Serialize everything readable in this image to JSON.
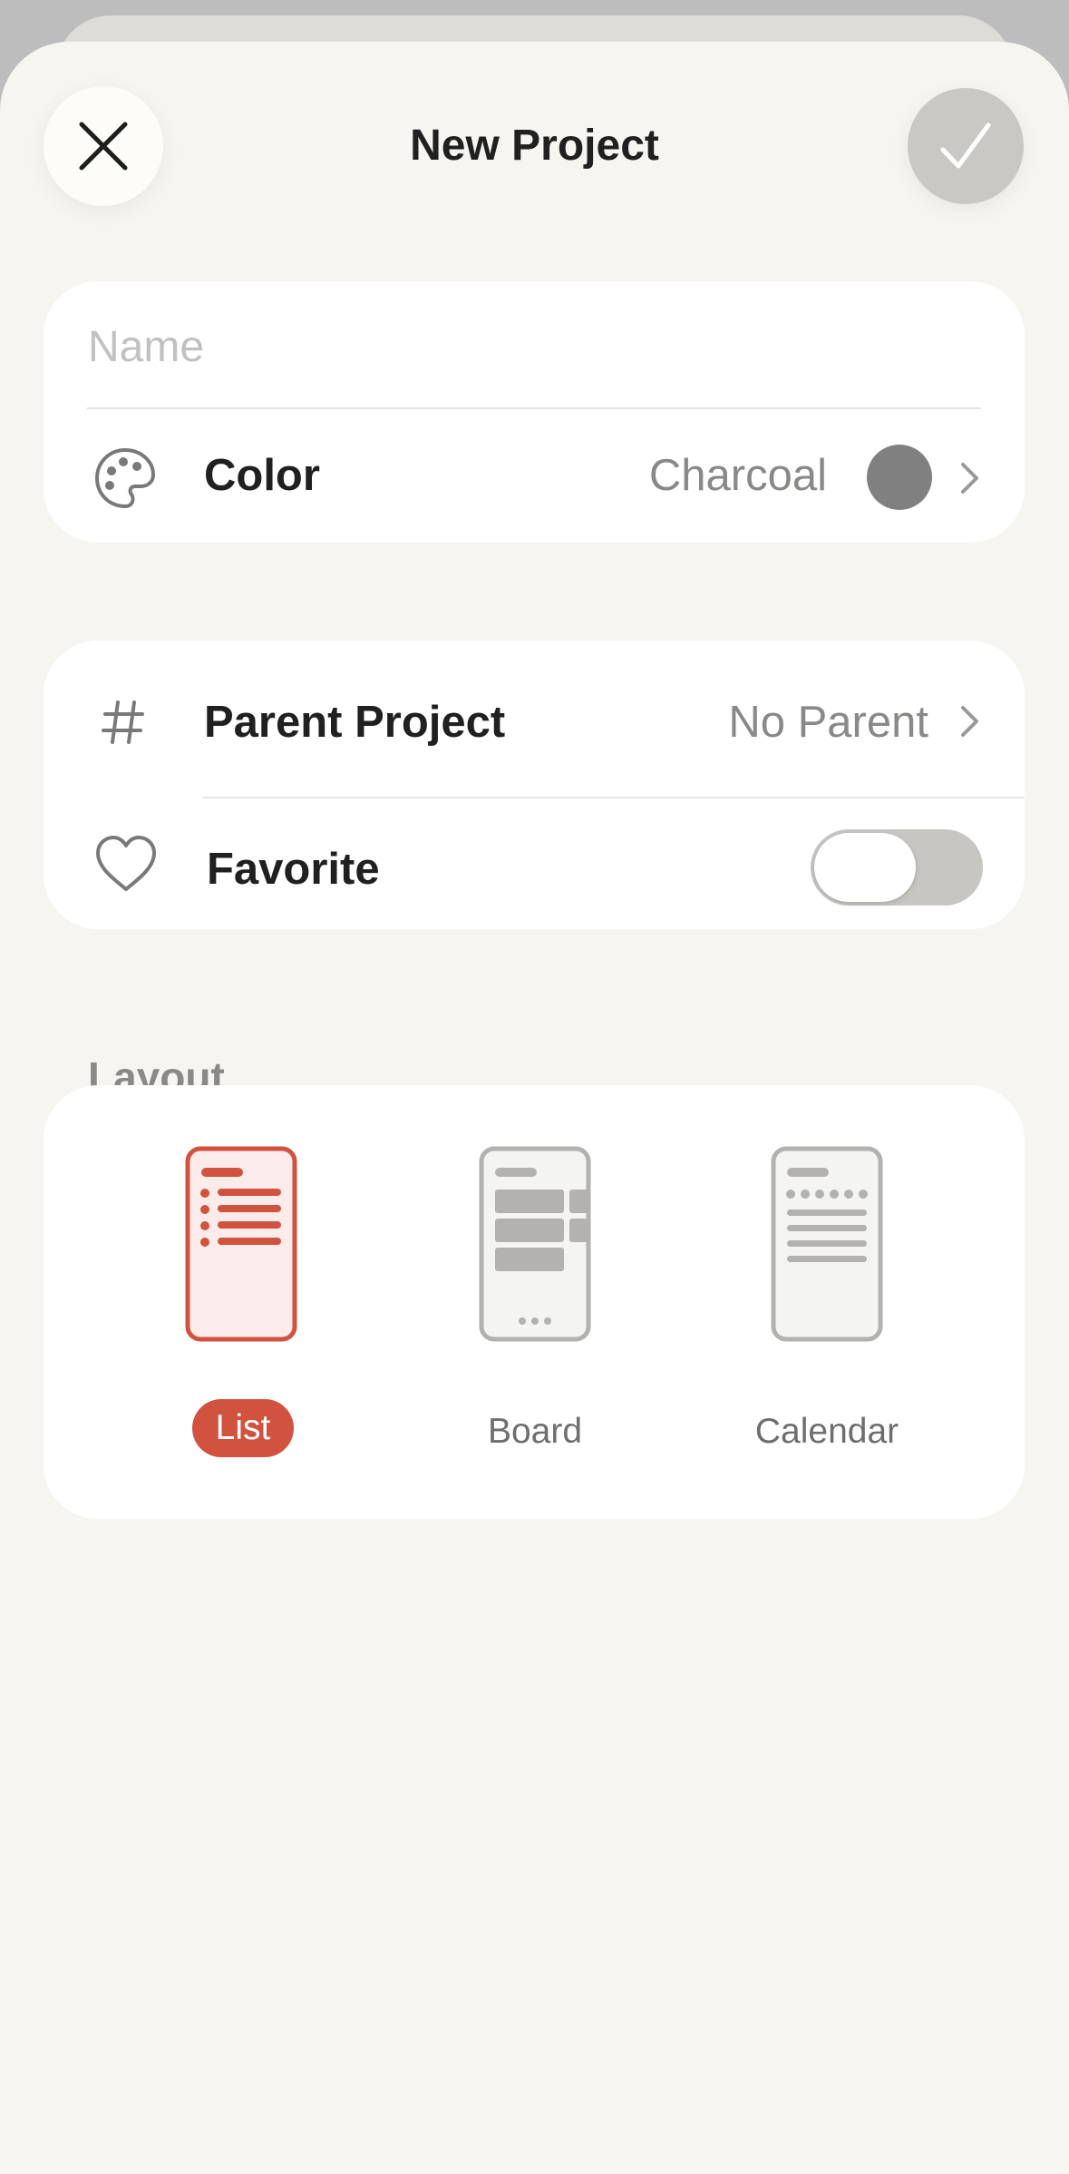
{
  "header": {
    "title": "New Project",
    "close_icon": "close-icon",
    "done_icon": "checkmark-icon"
  },
  "name_field": {
    "placeholder": "Name",
    "value": ""
  },
  "color_row": {
    "icon": "palette-icon",
    "label": "Color",
    "value": "Charcoal",
    "swatch_color": "#808080"
  },
  "parent_row": {
    "icon": "hash-icon",
    "label": "Parent Project",
    "value": "No Parent"
  },
  "favorite_row": {
    "icon": "heart-icon",
    "label": "Favorite",
    "toggle_on": false
  },
  "layout": {
    "section_label": "Layout",
    "selected": "List",
    "options": [
      {
        "label": "List",
        "icon": "list-layout-icon"
      },
      {
        "label": "Board",
        "icon": "board-layout-icon"
      },
      {
        "label": "Calendar",
        "icon": "calendar-layout-icon"
      }
    ]
  },
  "colors": {
    "accent": "#d1533f",
    "background": "#f6f5f2",
    "card": "#ffffff",
    "text_primary": "#202020",
    "text_secondary": "#8a8987"
  }
}
